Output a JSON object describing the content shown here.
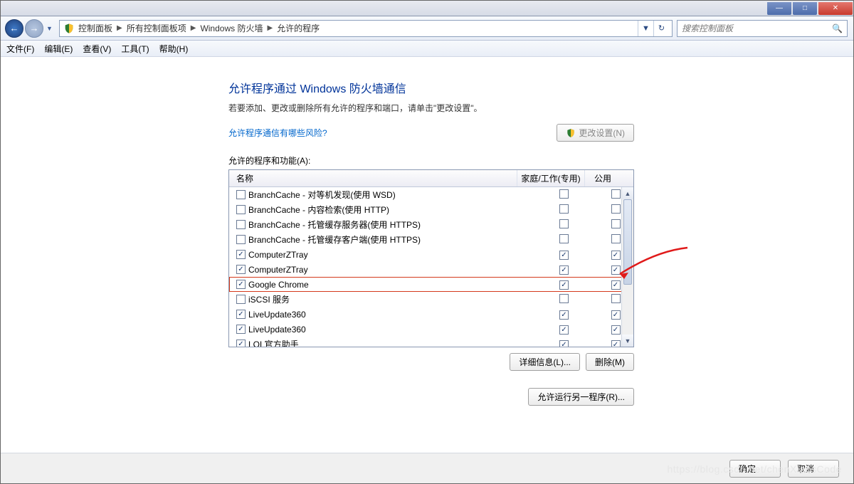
{
  "window_controls": {
    "min": "—",
    "max": "□",
    "close": "✕"
  },
  "nav": {
    "back": "←",
    "forward": "→",
    "crumbs": [
      "控制面板",
      "所有控制面板项",
      "Windows 防火墙",
      "允许的程序"
    ],
    "refresh": "↻",
    "search_placeholder": "搜索控制面板"
  },
  "menubar": [
    "文件(F)",
    "编辑(E)",
    "查看(V)",
    "工具(T)",
    "帮助(H)"
  ],
  "heading": "允许程序通过 Windows 防火墙通信",
  "description": "若要添加、更改或删除所有允许的程序和端口，请单击\"更改设置\"。",
  "risk_link": "允许程序通信有哪些风险?",
  "change_settings_btn": "更改设置(N)",
  "section_label": "允许的程序和功能(A):",
  "columns": {
    "name": "名称",
    "home": "家庭/工作(专用)",
    "public": "公用"
  },
  "rows": [
    {
      "enabled": false,
      "name": "BranchCache - 对等机发现(使用 WSD)",
      "home": false,
      "pub": false,
      "hl": false
    },
    {
      "enabled": false,
      "name": "BranchCache - 内容检索(使用 HTTP)",
      "home": false,
      "pub": false,
      "hl": false
    },
    {
      "enabled": false,
      "name": "BranchCache - 托管缓存服务器(使用 HTTPS)",
      "home": false,
      "pub": false,
      "hl": false
    },
    {
      "enabled": false,
      "name": "BranchCache - 托管缓存客户端(使用 HTTPS)",
      "home": false,
      "pub": false,
      "hl": false
    },
    {
      "enabled": true,
      "name": "ComputerZTray",
      "home": true,
      "pub": true,
      "hl": false
    },
    {
      "enabled": true,
      "name": "ComputerZTray",
      "home": true,
      "pub": true,
      "hl": false
    },
    {
      "enabled": true,
      "name": "Google Chrome",
      "home": true,
      "pub": true,
      "hl": true
    },
    {
      "enabled": false,
      "name": "iSCSI 服务",
      "home": false,
      "pub": false,
      "hl": false
    },
    {
      "enabled": true,
      "name": "LiveUpdate360",
      "home": true,
      "pub": true,
      "hl": false
    },
    {
      "enabled": true,
      "name": "LiveUpdate360",
      "home": true,
      "pub": true,
      "hl": false
    },
    {
      "enabled": true,
      "name": "LOL官方助手",
      "home": true,
      "pub": true,
      "hl": false
    }
  ],
  "details_btn": "详细信息(L)...",
  "remove_btn": "删除(M)",
  "allow_another_btn": "允许运行另一程序(R)...",
  "ok_btn": "确定",
  "cancel_btn": "取消",
  "watermark": "https://blog.csdn.net/chenXiaosCode"
}
